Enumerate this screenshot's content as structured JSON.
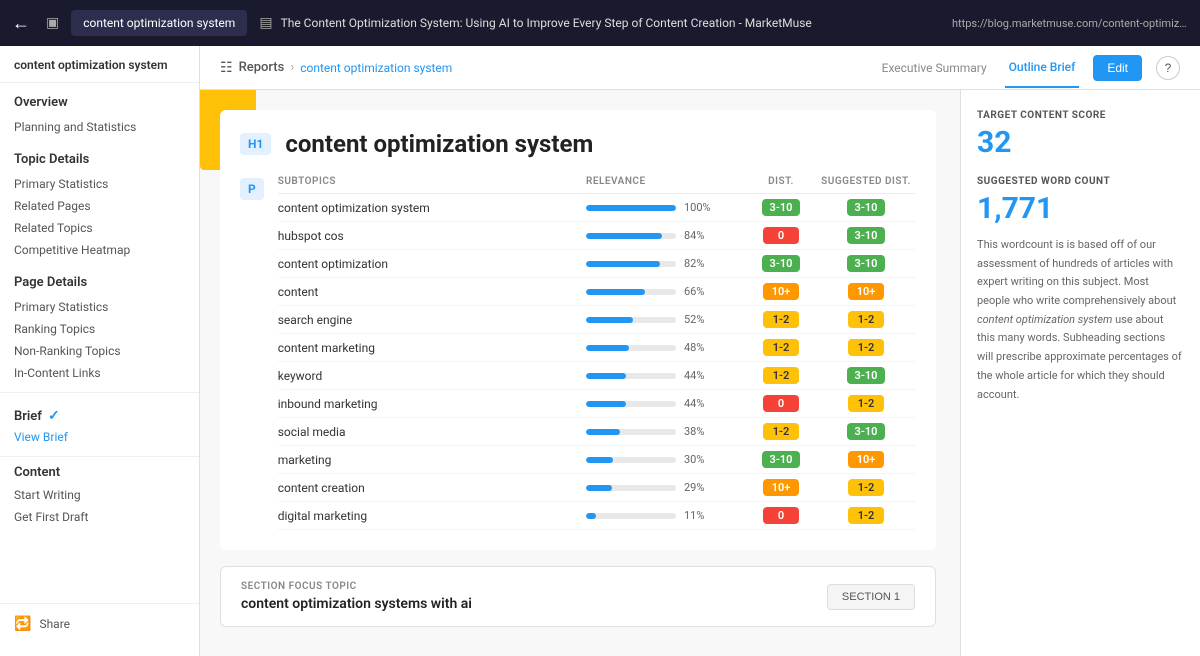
{
  "topbar": {
    "brand": "content optimization system",
    "page_title": "The Content Optimization System: Using AI to Improve Every Step of Content Creation - MarketMuse",
    "url": "https://blog.marketmuse.com/content-optimization-system/"
  },
  "breadcrumb": {
    "reports": "Reports",
    "separator": "›",
    "current": "content optimization system"
  },
  "tabs": {
    "executive_summary": "Executive Summary",
    "outline_brief": "Outline Brief"
  },
  "toolbar": {
    "edit_label": "Edit"
  },
  "sidebar": {
    "brand": "content optimization system",
    "overview": "Overview",
    "planning_statistics": "Planning and Statistics",
    "topic_details": "Topic Details",
    "primary_statistics_td": "Primary Statistics",
    "related_pages": "Related Pages",
    "related_topics": "Related Topics",
    "competitive": "Competitive Heatmap",
    "page_details": "Page Details",
    "primary_statistics_pd": "Primary Statistics",
    "ranking_topics": "Ranking Topics",
    "non_ranking_topics": "Non-Ranking Topics",
    "in_content_links": "In-Content Links",
    "brief": "Brief",
    "view_brief": "View Brief",
    "content": "Content",
    "start_writing": "Start Writing",
    "get_first_draft": "Get First Draft",
    "share": "Share"
  },
  "article": {
    "h1_badge": "H1",
    "title": "content optimization system",
    "p_badge": "P",
    "table_headers": {
      "subtopics": "SUBTOPICS",
      "relevance": "RELEVANCE",
      "dist": "DIST.",
      "suggested_dist": "SUGGESTED DIST."
    },
    "rows": [
      {
        "topic": "content optimization system",
        "relevance": 100,
        "relevance_pct": "100%",
        "dist": "3-10",
        "dist_color": "green",
        "suggested": "3-10",
        "suggested_color": "green"
      },
      {
        "topic": "hubspot cos",
        "relevance": 84,
        "relevance_pct": "84%",
        "dist": "0",
        "dist_color": "red",
        "suggested": "3-10",
        "suggested_color": "green"
      },
      {
        "topic": "content optimization",
        "relevance": 82,
        "relevance_pct": "82%",
        "dist": "3-10",
        "dist_color": "green",
        "suggested": "3-10",
        "suggested_color": "green"
      },
      {
        "topic": "content",
        "relevance": 66,
        "relevance_pct": "66%",
        "dist": "10+",
        "dist_color": "orange",
        "suggested": "10+",
        "suggested_color": "orange"
      },
      {
        "topic": "search engine",
        "relevance": 52,
        "relevance_pct": "52%",
        "dist": "1-2",
        "dist_color": "yellow",
        "suggested": "1-2",
        "suggested_color": "yellow"
      },
      {
        "topic": "content marketing",
        "relevance": 48,
        "relevance_pct": "48%",
        "dist": "1-2",
        "dist_color": "yellow",
        "suggested": "1-2",
        "suggested_color": "yellow"
      },
      {
        "topic": "keyword",
        "relevance": 44,
        "relevance_pct": "44%",
        "dist": "1-2",
        "dist_color": "yellow",
        "suggested": "3-10",
        "suggested_color": "green"
      },
      {
        "topic": "inbound marketing",
        "relevance": 44,
        "relevance_pct": "44%",
        "dist": "0",
        "dist_color": "red",
        "suggested": "1-2",
        "suggested_color": "yellow"
      },
      {
        "topic": "social media",
        "relevance": 38,
        "relevance_pct": "38%",
        "dist": "1-2",
        "dist_color": "yellow",
        "suggested": "3-10",
        "suggested_color": "green"
      },
      {
        "topic": "marketing",
        "relevance": 30,
        "relevance_pct": "30%",
        "dist": "3-10",
        "dist_color": "green",
        "suggested": "10+",
        "suggested_color": "orange"
      },
      {
        "topic": "content creation",
        "relevance": 29,
        "relevance_pct": "29%",
        "dist": "10+",
        "dist_color": "orange",
        "suggested": "1-2",
        "suggested_color": "yellow"
      },
      {
        "topic": "digital marketing",
        "relevance": 11,
        "relevance_pct": "11%",
        "dist": "0",
        "dist_color": "red",
        "suggested": "1-2",
        "suggested_color": "yellow"
      }
    ],
    "section_focus_label": "SECTION FOCUS TOPIC",
    "section_focus_topic": "content optimization systems with ai",
    "section_btn": "SECTION 1"
  },
  "right_panel": {
    "target_score_label": "TARGET CONTENT SCORE",
    "target_score": "32",
    "wordcount_label": "SUGGESTED WORD COUNT",
    "wordcount": "1,771",
    "wordcount_desc_1": "This wordcount is is based off of our assessment of hundreds of articles with expert writing on this subject. Most people who write comprehensively about ",
    "wordcount_em": "content optimization system",
    "wordcount_desc_2": " use about this many words. Subheading sections will prescribe approximate percentages of the whole article for which they should account."
  }
}
